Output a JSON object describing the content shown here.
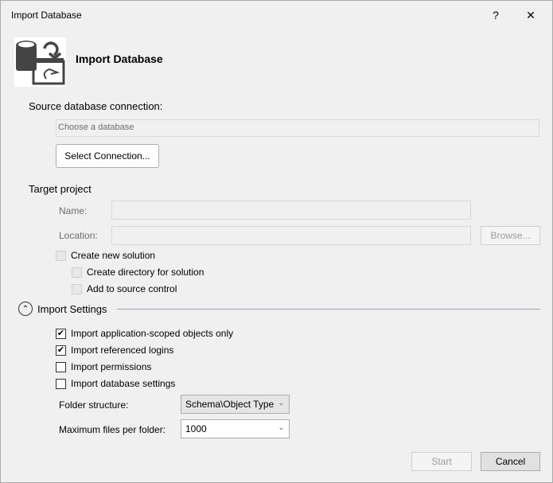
{
  "window": {
    "title": "Import Database",
    "help_label": "?",
    "close_label": "✕"
  },
  "header": {
    "title": "Import Database",
    "icon": "import-database-icon"
  },
  "source": {
    "label": "Source database connection:",
    "placeholder": "Choose a database",
    "select_button": "Select Connection..."
  },
  "target": {
    "label": "Target project",
    "name_label": "Name:",
    "name_value": "",
    "location_label": "Location:",
    "location_value": "",
    "browse_button": "Browse...",
    "create_solution": {
      "label": "Create new solution",
      "checked": false,
      "enabled": false
    },
    "create_directory": {
      "label": "Create directory for solution",
      "checked": false,
      "enabled": false
    },
    "source_control": {
      "label": "Add to source control",
      "checked": false,
      "enabled": false
    }
  },
  "settings": {
    "label": "Import Settings",
    "expanded": true,
    "options": [
      {
        "label": "Import application-scoped objects only",
        "checked": true
      },
      {
        "label": "Import referenced logins",
        "checked": true
      },
      {
        "label": "Import permissions",
        "checked": false
      },
      {
        "label": "Import database settings",
        "checked": false
      }
    ],
    "folder_label": "Folder structure:",
    "folder_value": "Schema\\Object Type",
    "max_files_label": "Maximum files per folder:",
    "max_files_value": "1000"
  },
  "footer": {
    "start_button": "Start",
    "cancel_button": "Cancel"
  }
}
